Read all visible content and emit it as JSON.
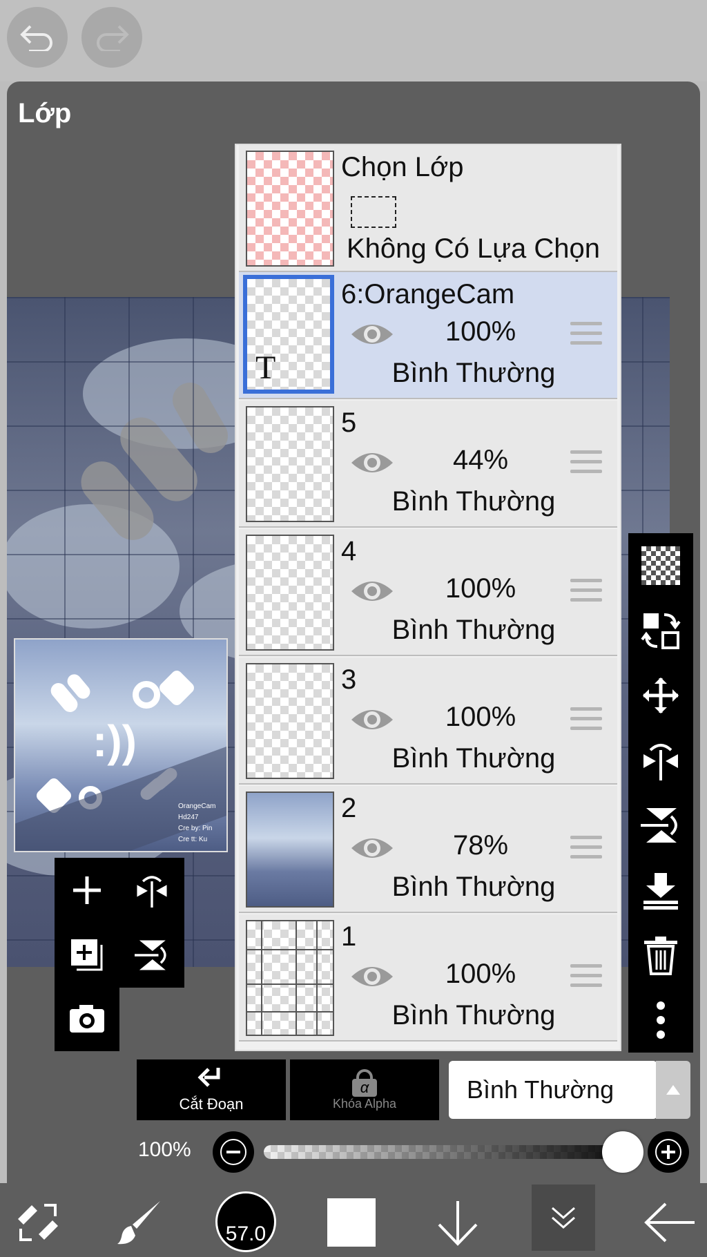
{
  "panel": {
    "title": "Lớp"
  },
  "selection_layer": {
    "label": "Chọn Lớp",
    "status": "Không Có Lựa Chọn"
  },
  "layers": [
    {
      "name": "6:OrangeCam",
      "opacity": "100%",
      "blend": "Bình Thường",
      "selected": true,
      "text_badge": "T"
    },
    {
      "name": "5",
      "opacity": "44%",
      "blend": "Bình Thường"
    },
    {
      "name": "4",
      "opacity": "100%",
      "blend": "Bình Thường"
    },
    {
      "name": "3",
      "opacity": "100%",
      "blend": "Bình Thường"
    },
    {
      "name": "2",
      "opacity": "78%",
      "blend": "Bình Thường"
    },
    {
      "name": "1",
      "opacity": "100%",
      "blend": "Bình Thường"
    }
  ],
  "controls": {
    "clip_label": "Cắt Đoạn",
    "alpha_lock_label": "Khóa Alpha",
    "alpha_glyph": "α",
    "blend_mode": "Bình Thường",
    "opacity_value": "100%",
    "opacity_level": 1.0
  },
  "preview_text": [
    "OrangeCam",
    "Hd247",
    "Cre by: Pin",
    "Cre tt: Ku"
  ],
  "preview_smiley": ":))",
  "bottom_bar": {
    "brush_size": "57.0"
  },
  "colors": {
    "selected_row": "#d2dbef",
    "selected_border": "#3a6fd8",
    "panel_bg": "#5e5e5e"
  }
}
